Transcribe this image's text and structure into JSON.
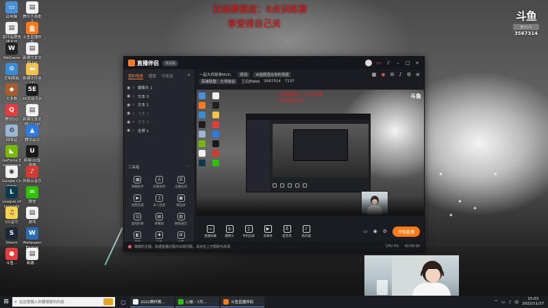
{
  "overlay": {
    "title_line1": "双缘赛赛度：8点训练赛",
    "title_line2": "享受得自己关"
  },
  "douyu": {
    "brand": "斗鱼",
    "room_label": "房间号",
    "room_number": "3567314"
  },
  "desktop_icons": [
    {
      "label": "此电脑",
      "color": "#4a90d9",
      "glyph": "▭"
    },
    {
      "label": "腾讯手游助手",
      "color": "#f0f0f0",
      "glyph": "▤"
    },
    {
      "label": "双环金牌快捷方式",
      "color": "#f0f0f0",
      "glyph": "▤"
    },
    {
      "label": "斗鱼直播伴侣",
      "color": "#ff7a18",
      "glyph": "鱼"
    },
    {
      "label": "WeGame",
      "color": "#222",
      "glyph": "W"
    },
    {
      "label": "新建文本文档.txt",
      "color": "#f0f0f0",
      "glyph": "▤"
    },
    {
      "label": "控制面板",
      "color": "#3a8bd6",
      "glyph": "⚙"
    },
    {
      "label": "新建文件夹(3)",
      "color": "#f2c24c",
      "glyph": "▬"
    },
    {
      "label": "大多数",
      "color": "#a85d2a",
      "glyph": "◆"
    },
    {
      "label": "5E对战平台",
      "color": "#1e1e1e",
      "glyph": "5E"
    },
    {
      "label": "腾讯QQ",
      "color": "#e73c3c",
      "glyph": "Q"
    },
    {
      "label": "新建文本文档(2).txt",
      "color": "#f0f0f0",
      "glyph": "▤"
    },
    {
      "label": "回收站",
      "color": "#9bb7d4",
      "glyph": "♻"
    },
    {
      "label": "腾讯会议",
      "color": "#2c7be5",
      "glyph": "▲"
    },
    {
      "label": "GeForce Experience",
      "color": "#76b900",
      "glyph": "◣"
    },
    {
      "label": "网易UU加速器",
      "color": "#1a1a1a",
      "glyph": "U"
    },
    {
      "label": "Google Chrome",
      "color": "#f2f2f2",
      "glyph": "◉"
    },
    {
      "label": "网易云音乐",
      "color": "#d33a31",
      "glyph": "♪"
    },
    {
      "label": "League of Legends",
      "color": "#0a3b4a",
      "glyph": "L"
    },
    {
      "label": "微信",
      "color": "#2dc100",
      "glyph": "✉"
    },
    {
      "label": "QQ音乐",
      "color": "#f6d34c",
      "glyph": "♫"
    },
    {
      "label": "游戏",
      "color": "#f2f2f2",
      "glyph": "▤"
    },
    {
      "label": "Steam",
      "color": "#1b2838",
      "glyph": "S"
    },
    {
      "label": "Wallpaper Engine",
      "color": "#2b6cb0",
      "glyph": "W"
    },
    {
      "label": "斗鱼...",
      "color": "#e73c3c",
      "glyph": "●"
    },
    {
      "label": "新建...",
      "color": "#f0f0f0",
      "glyph": "▤"
    }
  ],
  "app": {
    "name": "直播伴侣",
    "badge": "测试版",
    "title_icons": [
      "avatar",
      "screen",
      "bell",
      "minimize",
      "maximize",
      "close"
    ],
    "sidebar_tabs": [
      "我的场景",
      "图层",
      "可发送"
    ],
    "sidebar_add": "+",
    "scenes": [
      {
        "name": "摄像头 1",
        "dim": false
      },
      {
        "name": "文本 3",
        "dim": false
      },
      {
        "name": "文本 1",
        "dim": false
      },
      {
        "name": "文本 2",
        "dim": true
      },
      {
        "name": "文本 4",
        "dim": true
      },
      {
        "name": "全屏 1",
        "dim": false
      }
    ],
    "tools_title": "工具箱",
    "tools_more": "⋯",
    "tools": [
      {
        "label": "弹幕助手",
        "glyph": "▦"
      },
      {
        "label": "房管助手",
        "glyph": "♙"
      },
      {
        "label": "主播任务",
        "glyph": "☰"
      },
      {
        "label": "视频连麦",
        "glyph": "▶"
      },
      {
        "label": "多人连麦",
        "glyph": "♫"
      },
      {
        "label": "摸鱼屏",
        "glyph": "▣"
      },
      {
        "label": "虚拟形象",
        "glyph": "☺"
      },
      {
        "label": "弹幕屏",
        "glyph": "▤"
      },
      {
        "label": "数据报告",
        "glyph": "▥"
      },
      {
        "label": "游戏",
        "glyph": "◧"
      },
      {
        "label": "工具",
        "glyph": "✚"
      },
      {
        "label": "设置",
        "glyph": "⚙"
      }
    ],
    "room_title": "一起大师局拿MVP。",
    "room_tag1": "修改",
    "room_tag2": "#选择适合你的场景",
    "room_category": "英雄联盟 · 大师峡谷",
    "room_user": "王后的666",
    "room_id": "3567314",
    "room_fans": "7137",
    "toolbar_icons": [
      "gift",
      "record",
      "chat",
      "bell",
      "settings",
      "more"
    ],
    "preview_title1": "双缘赛赛度：8点训练赛",
    "preview_title2": "享受得自己关",
    "preview_logo": "斗鱼",
    "controls": [
      {
        "label": "直播屏幕",
        "glyph": "▭"
      },
      {
        "label": "摄像头",
        "glyph": "◎"
      },
      {
        "label": "手机投屏",
        "glyph": "▯"
      },
      {
        "label": "多媒体",
        "glyph": "▶"
      },
      {
        "label": "麦克风",
        "glyph": "♁"
      },
      {
        "label": "扬声器",
        "glyph": "♪"
      }
    ],
    "control_extra": [
      "▭",
      "◉",
      "⚙"
    ],
    "go_live": "开始直播",
    "status_text": "尊敬的主播，如遇直播过程中出现问题，请点击上方帮助与反馈",
    "status_right": [
      "CPU 0%",
      "00:00:00"
    ]
  },
  "taskbar": {
    "start_icon": "windows-icon",
    "search_placeholder": "在这里输入你要搜索的内容",
    "tasks": [
      {
        "label": "2022赛杯赛...",
        "color": "#f2f2f2"
      },
      {
        "label": "心愉 - 7月...",
        "color": "#2dc100"
      },
      {
        "label": "斗鱼直播伴侣",
        "color": "#ff7a18"
      }
    ],
    "tray_icons": [
      "^",
      "▭",
      "♪",
      "中"
    ],
    "time": "15:03",
    "date": "2022/11/27"
  }
}
